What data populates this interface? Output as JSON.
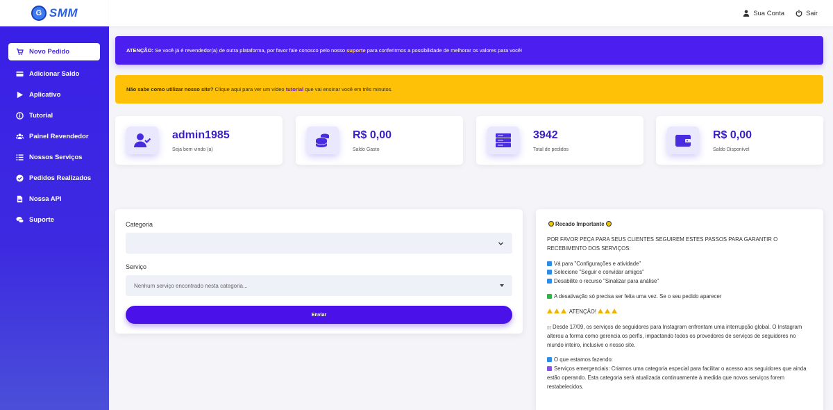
{
  "brand": {
    "logo_letter": "G",
    "name": "SMM"
  },
  "header": {
    "account_label": "Sua Conta",
    "logout_label": "Sair"
  },
  "sidebar": {
    "items": [
      {
        "label": "Novo Pedido",
        "icon": "cart-icon",
        "active": true
      },
      {
        "label": "Adicionar Saldo",
        "icon": "credit-card-icon"
      },
      {
        "label": "Aplicativo",
        "icon": "play-icon"
      },
      {
        "label": "Tutorial",
        "icon": "info-icon"
      },
      {
        "label": "Painel Revendedor",
        "icon": "users-icon"
      },
      {
        "label": "Nossos Serviços",
        "icon": "list-icon"
      },
      {
        "label": "Pedidos Realizados",
        "icon": "check-circle-icon"
      },
      {
        "label": "Nossa API",
        "icon": "file-icon"
      },
      {
        "label": "Suporte",
        "icon": "chat-icon"
      }
    ]
  },
  "alerts": {
    "reseller": {
      "lead": "ATENÇÃO:",
      "pre": " Se você já é revendedor(a) de outra plataforma, por favor fale conosco pelo nosso ",
      "link": "suporte",
      "post": " para conferirmos a possibilidade de melhorar os valores para você!"
    },
    "tutorial": {
      "lead": "Não sabe como utilizar nosso site?",
      "pre": " Clique aqui para ver um vídeo ",
      "link": "tutorial",
      "post": " que vai ensinar você em três minutos."
    }
  },
  "stats": [
    {
      "value": "admin1985",
      "label": "Seja bem vindo (a)",
      "icon": "user-check-icon"
    },
    {
      "value": "R$ 0,00",
      "label": "Saldo Gasto",
      "icon": "coins-icon"
    },
    {
      "value": "3942",
      "label": "Total de pedidos",
      "icon": "server-icon"
    },
    {
      "value": "R$ 0,00",
      "label": "Saldo Disponível",
      "icon": "wallet-icon"
    }
  ],
  "order_form": {
    "category_label": "Categoria",
    "category_value": "",
    "service_label": "Serviço",
    "service_value": "Nenhum serviço encontrado nesta categoria...",
    "submit_label": "Enviar"
  },
  "notice": {
    "title": "Recado Importante",
    "intro": "POR FAVOR PEÇA PARA SEUS CLIENTES SEGUIREM ESTES PASSOS PARA GARANTIR O RECEBIMENTO DOS SERVIÇOS:",
    "steps": [
      "Vá para \"Configurações e atividade\"",
      "Selecione \"Seguir e convidar amigos\"",
      "Desabilite o recurso \"Sinalizar para análise\""
    ],
    "deactivation": "A desativação só precisa ser feita uma vez. Se o seu pedido aparecer",
    "warning_title": "ATENÇÃO!",
    "outage": "Desde 17/09, os serviços de seguidores para Instagram enfrentam uma interrupção global. O Instagram alterou a forma como gerencia os perfis, impactando todos os provedores de serviços de seguidores no mundo inteiro, inclusive o nosso site.",
    "doing_title": "O que estamos fazendo:",
    "emergency": "Serviços emergenciais: Criamos uma categoria especial para facilitar o acesso aos seguidores que ainda estão operando. Esta categoria será atualizada continuamente à medida que novos serviços forem restabelecidos."
  },
  "colors": {
    "primary": "#4a12e8",
    "warning": "#ffc107",
    "accent_text": "#3b1dc9"
  }
}
